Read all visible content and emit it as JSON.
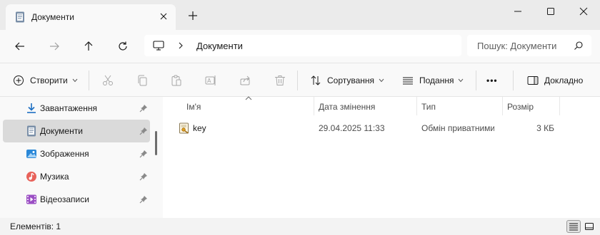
{
  "tab": {
    "title": "Документи",
    "tab_icon": "documents-icon",
    "close_icon": "close-icon",
    "new_tab_icon": "plus-icon"
  },
  "window_controls": [
    "minimize-icon",
    "maximize-icon",
    "close-icon"
  ],
  "nav": {
    "buttons": [
      "back-arrow-icon",
      "forward-arrow-icon",
      "up-arrow-icon",
      "refresh-icon"
    ],
    "address": {
      "icon": "computer-icon",
      "separator": "chevron-right-icon",
      "location": "Документи"
    },
    "search": {
      "placeholder": "Пошук: Документи",
      "icon": "search-icon"
    }
  },
  "toolbar": {
    "new_label": "Створити",
    "icons": [
      "cut-icon",
      "copy-icon",
      "paste-icon",
      "rename-icon",
      "share-icon",
      "delete-icon"
    ],
    "sort_label": "Сортування",
    "view_label": "Подання",
    "more_label": "•••",
    "details_label": "Докладно"
  },
  "sidebar": {
    "items": [
      {
        "label": "Завантаження",
        "icon": "download-icon",
        "selected": false
      },
      {
        "label": "Документи",
        "icon": "documents-icon",
        "selected": true
      },
      {
        "label": "Зображення",
        "icon": "pictures-icon",
        "selected": false
      },
      {
        "label": "Музика",
        "icon": "music-icon",
        "selected": false
      },
      {
        "label": "Відеозаписи",
        "icon": "videos-icon",
        "selected": false
      }
    ],
    "pin_icon": "pin-icon"
  },
  "columns": {
    "name": "Ім'я",
    "date": "Дата змінення",
    "type": "Тип",
    "size": "Розмір"
  },
  "files": [
    {
      "name": "key",
      "date": "29.04.2025 11:33",
      "type": "Обмін приватними ключами",
      "size": "3 КБ",
      "icon": "certificate-key-icon"
    }
  ],
  "status": {
    "text": "Елементів: 1",
    "view_icons": [
      "details-view-icon",
      "tiles-view-icon"
    ]
  },
  "colors": {
    "selected": "#dadada",
    "accent": "#0067c0"
  }
}
